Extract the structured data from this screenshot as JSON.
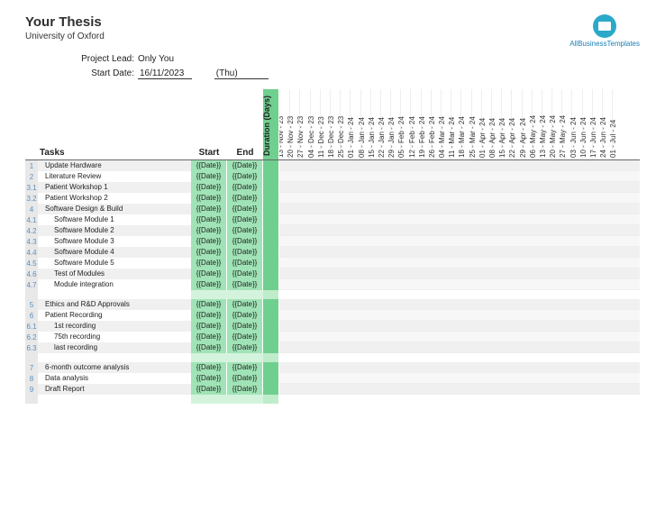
{
  "header": {
    "title": "Your Thesis",
    "subtitle": "University of Oxford",
    "logo_text": "AllBusinessTemplates"
  },
  "meta": {
    "project_lead_label": "Project Lead:",
    "project_lead_value": "Only You",
    "start_date_label": "Start Date:",
    "start_date_value": "16/11/2023",
    "start_date_day": "(Thu)"
  },
  "columns": {
    "tasks": "Tasks",
    "start": "Start",
    "end": "End",
    "duration": "Duration (Days)"
  },
  "dates": [
    "13 - Nov - 23",
    "20 - Nov - 23",
    "27 - Nov - 23",
    "04 - Dec - 23",
    "11 - Dec - 23",
    "18 - Dec - 23",
    "25 - Dec - 23",
    "01 - Jan - 24",
    "08 - Jan - 24",
    "15 - Jan - 24",
    "22 - Jan - 24",
    "29 - Jan - 24",
    "05 - Feb - 24",
    "12 - Feb - 24",
    "19 - Feb - 24",
    "26 - Feb - 24",
    "04 - Mar - 24",
    "11 - Mar - 24",
    "18 - Mar - 24",
    "25 - Mar - 24",
    "01 - Apr - 24",
    "08 - Apr - 24",
    "15 - Apr - 24",
    "22 - Apr - 24",
    "29 - Apr - 24",
    "06 - May - 24",
    "13 - May - 24",
    "20 - May - 24",
    "27 - May - 24",
    "03 - Jun - 24",
    "10 - Jun - 24",
    "17 - Jun - 24",
    "24 - Jun - 24",
    "01 - Jul - 24"
  ],
  "groups": [
    {
      "rows": [
        {
          "id": "1",
          "name": "Update Hardware",
          "start": "{{Date}}",
          "end": "{{Date}}",
          "indent": false
        },
        {
          "id": "2",
          "name": "Literature Review",
          "start": "{{Date}}",
          "end": "{{Date}}",
          "indent": false
        },
        {
          "id": "3.1",
          "name": "Patient Workshop 1",
          "start": "{{Date}}",
          "end": "{{Date}}",
          "indent": false
        },
        {
          "id": "3.2",
          "name": "Patient Workshop 2",
          "start": "{{Date}}",
          "end": "{{Date}}",
          "indent": false
        },
        {
          "id": "4",
          "name": "Software Design & Build",
          "start": "{{Date}}",
          "end": "{{Date}}",
          "indent": false
        },
        {
          "id": "4.1",
          "name": "Software Module 1",
          "start": "{{Date}}",
          "end": "{{Date}}",
          "indent": true
        },
        {
          "id": "4.2",
          "name": "Software Module 2",
          "start": "{{Date}}",
          "end": "{{Date}}",
          "indent": true
        },
        {
          "id": "4.3",
          "name": "Software Module 3",
          "start": "{{Date}}",
          "end": "{{Date}}",
          "indent": true
        },
        {
          "id": "4.4",
          "name": "Software Module 4",
          "start": "{{Date}}",
          "end": "{{Date}}",
          "indent": true
        },
        {
          "id": "4.5",
          "name": "Software Module 5",
          "start": "{{Date}}",
          "end": "{{Date}}",
          "indent": true
        },
        {
          "id": "4.6",
          "name": "Test of Modules",
          "start": "{{Date}}",
          "end": "{{Date}}",
          "indent": true
        },
        {
          "id": "4.7",
          "name": "Module integration",
          "start": "{{Date}}",
          "end": "{{Date}}",
          "indent": true
        }
      ]
    },
    {
      "rows": [
        {
          "id": "5",
          "name": "Ethics and R&D Approvals",
          "start": "{{Date}}",
          "end": "{{Date}}",
          "indent": false
        },
        {
          "id": "6",
          "name": "Patient Recording",
          "start": "{{Date}}",
          "end": "{{Date}}",
          "indent": false
        },
        {
          "id": "6.1",
          "name": "1st recording",
          "start": "{{Date}}",
          "end": "{{Date}}",
          "indent": true
        },
        {
          "id": "6.2",
          "name": "75th recording",
          "start": "{{Date}}",
          "end": "{{Date}}",
          "indent": true
        },
        {
          "id": "6.3",
          "name": "last recording",
          "start": "{{Date}}",
          "end": "{{Date}}",
          "indent": true
        }
      ]
    },
    {
      "rows": [
        {
          "id": "7",
          "name": "6-month outcome analysis",
          "start": "{{Date}}",
          "end": "{{Date}}",
          "indent": false
        },
        {
          "id": "8",
          "name": "Data analysis",
          "start": "{{Date}}",
          "end": "{{Date}}",
          "indent": false
        },
        {
          "id": "9",
          "name": "Draft Report",
          "start": "{{Date}}",
          "end": "{{Date}}",
          "indent": false
        }
      ]
    }
  ]
}
